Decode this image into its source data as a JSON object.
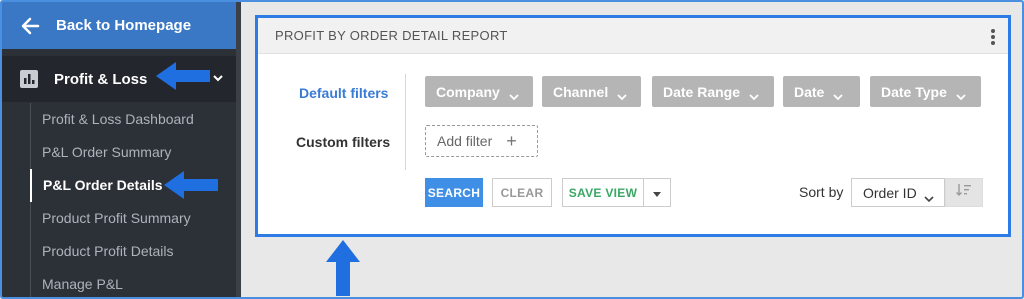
{
  "sidebar": {
    "back_label": "Back to Homepage",
    "section_label": "Profit & Loss",
    "items": [
      {
        "label": "Profit & Loss Dashboard"
      },
      {
        "label": "P&L Order Summary"
      },
      {
        "label": "P&L Order Details"
      },
      {
        "label": "Product Profit Summary"
      },
      {
        "label": "Product Profit Details"
      },
      {
        "label": "Manage P&L"
      }
    ],
    "active_item": "P&L Order Details"
  },
  "panel": {
    "title": "PROFIT BY ORDER DETAIL REPORT",
    "default_filters_label": "Default filters",
    "custom_filters_label": "Custom filters",
    "filter_chips": [
      {
        "label": "Company"
      },
      {
        "label": "Channel"
      },
      {
        "label": "Date Range"
      },
      {
        "label": "Date"
      },
      {
        "label": "Date Type"
      }
    ],
    "add_filter_label": "Add filter",
    "add_filter_icon": "+",
    "buttons": {
      "search": "SEARCH",
      "clear": "CLEAR",
      "save_view": "SAVE VIEW"
    },
    "sort_by_label": "Sort by",
    "sort_by_value": "Order ID"
  },
  "colors": {
    "accent": "#3a78c5",
    "highlight_border": "#2f7be6",
    "sidebar_bg": "#2c3138",
    "save_green": "#3aa864",
    "chip_grey": "#b5b5b5"
  }
}
